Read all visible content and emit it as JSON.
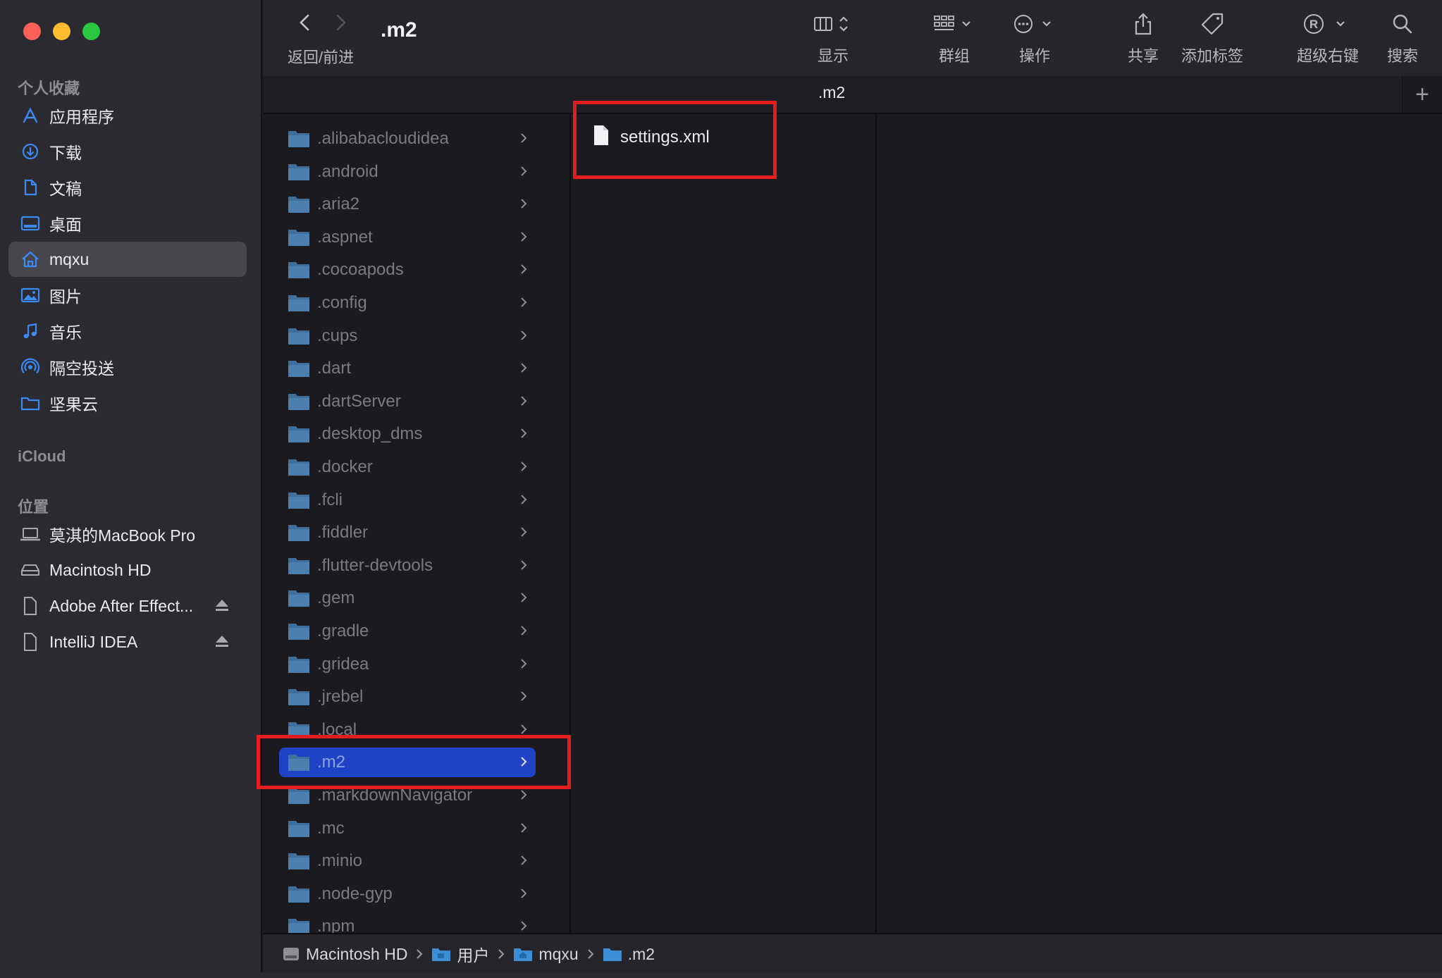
{
  "window": {
    "title": ".m2",
    "nav_label": "返回/前进",
    "tab_title": ".m2",
    "tab_add": "+"
  },
  "toolbar": {
    "view_label": "显示",
    "group_label": "群组",
    "action_label": "操作",
    "share_label": "共享",
    "tag_label": "添加标签",
    "superright_label": "超级右键",
    "search_label": "搜索"
  },
  "sidebar": {
    "favorites_title": "个人收藏",
    "favorites": [
      {
        "label": "应用程序",
        "icon": "apps-icon"
      },
      {
        "label": "下载",
        "icon": "download-icon"
      },
      {
        "label": "文稿",
        "icon": "document-icon"
      },
      {
        "label": "桌面",
        "icon": "desktop-icon"
      },
      {
        "label": "mqxu",
        "icon": "home-icon",
        "selected": true
      },
      {
        "label": "图片",
        "icon": "photo-icon"
      },
      {
        "label": "音乐",
        "icon": "music-icon"
      },
      {
        "label": "隔空投送",
        "icon": "airdrop-icon"
      },
      {
        "label": "坚果云",
        "icon": "folder-icon"
      }
    ],
    "icloud_title": "iCloud",
    "locations_title": "位置",
    "locations": [
      {
        "label": "莫淇的MacBook Pro",
        "icon": "laptop-icon"
      },
      {
        "label": "Macintosh HD",
        "icon": "disk-icon"
      },
      {
        "label": "Adobe After Effect...",
        "icon": "file-icon",
        "eject": true
      },
      {
        "label": "IntelliJ IDEA",
        "icon": "file-icon",
        "eject": true
      }
    ]
  },
  "column1": {
    "folders": [
      ".alibabacloudidea",
      ".android",
      ".aria2",
      ".aspnet",
      ".cocoapods",
      ".config",
      ".cups",
      ".dart",
      ".dartServer",
      ".desktop_dms",
      ".docker",
      ".fcli",
      ".fiddler",
      ".flutter-devtools",
      ".gem",
      ".gradle",
      ".gridea",
      ".jrebel",
      ".local",
      ".m2",
      ".markdownNavigator",
      ".mc",
      ".minio",
      ".node-gyp",
      ".npm"
    ],
    "selected": ".m2"
  },
  "column2": {
    "files": [
      "settings.xml"
    ]
  },
  "pathbar": {
    "crumbs": [
      "Macintosh HD",
      "用户",
      "mqxu",
      ".m2"
    ]
  },
  "colors": {
    "selection_blue": "#1f42c6",
    "highlight_red": "#e31d1d",
    "folder_blue": "#4d7fae"
  }
}
